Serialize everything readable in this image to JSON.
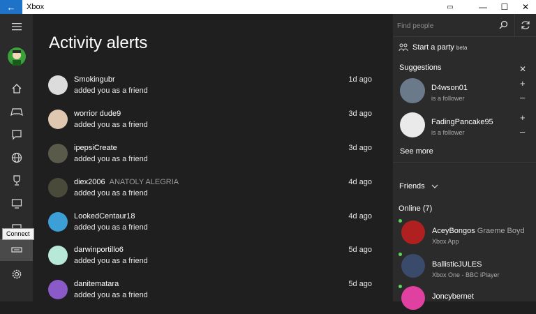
{
  "titlebar": {
    "app_title": "Xbox",
    "back_glyph": "←",
    "restore_glyph": "▭",
    "minimize_glyph": "—",
    "maximize_glyph": "☐",
    "close_glyph": "✕"
  },
  "nav": {
    "tooltip": "Connect",
    "icons": [
      "hamburger-icon",
      "avatar",
      "home-icon",
      "controller-icon",
      "chat-icon",
      "globe-icon",
      "trophy-icon",
      "game-dvr-icon",
      "store-icon",
      "connect-icon",
      "settings-icon"
    ]
  },
  "main": {
    "title": "Activity alerts",
    "alerts": [
      {
        "gamertag": "Smokingubr",
        "real_name": "",
        "action": "added you as a friend",
        "time": "1d ago",
        "avatar_color": "#dcdcdc"
      },
      {
        "gamertag": "worrior dude9",
        "real_name": "",
        "action": "added you as a friend",
        "time": "3d ago",
        "avatar_color": "#e0c8b0"
      },
      {
        "gamertag": "ipepsiCreate",
        "real_name": "",
        "action": "added you as a friend",
        "time": "3d ago",
        "avatar_color": "#5a5a4a"
      },
      {
        "gamertag": "diex2006",
        "real_name": "ANATOLY ALEGRIA",
        "action": "added you as a friend",
        "time": "4d ago",
        "avatar_color": "#4a4a3a"
      },
      {
        "gamertag": "LookedCentaur18",
        "real_name": "",
        "action": "added you as a friend",
        "time": "4d ago",
        "avatar_color": "#3c9fd6"
      },
      {
        "gamertag": "darwinportillo6",
        "real_name": "",
        "action": "added you as a friend",
        "time": "5d ago",
        "avatar_color": "#b8e8d8"
      },
      {
        "gamertag": "danitematara",
        "real_name": "",
        "action": "added you as a friend",
        "time": "5d ago",
        "avatar_color": "#8a5ac8"
      }
    ]
  },
  "right": {
    "search_placeholder": "Find people",
    "party_label": "Start a party",
    "party_beta": "beta",
    "suggestions_title": "Suggestions",
    "suggestions": [
      {
        "gamertag": "D4wson01",
        "sub": "is a follower",
        "avatar_color": "#6a7a8a"
      },
      {
        "gamertag": "FadingPancake95",
        "sub": "is a follower",
        "avatar_color": "#eaeaea"
      }
    ],
    "see_more": "See more",
    "friends_label": "Friends",
    "online_title": "Online (7)",
    "online": [
      {
        "gamertag": "AceyBongos",
        "real_name": "Graeme Boyd",
        "sub": "Xbox App",
        "avatar_color": "#b02020"
      },
      {
        "gamertag": "BallisticJULES",
        "real_name": "",
        "sub": "Xbox One - BBC iPlayer",
        "avatar_color": "#3a4a6a"
      },
      {
        "gamertag": "Joncybernet",
        "real_name": "",
        "sub": "",
        "avatar_color": "#e040a0"
      }
    ]
  },
  "colors": {
    "accent": "#1e73c8",
    "online_dot": "#5fd35a"
  }
}
